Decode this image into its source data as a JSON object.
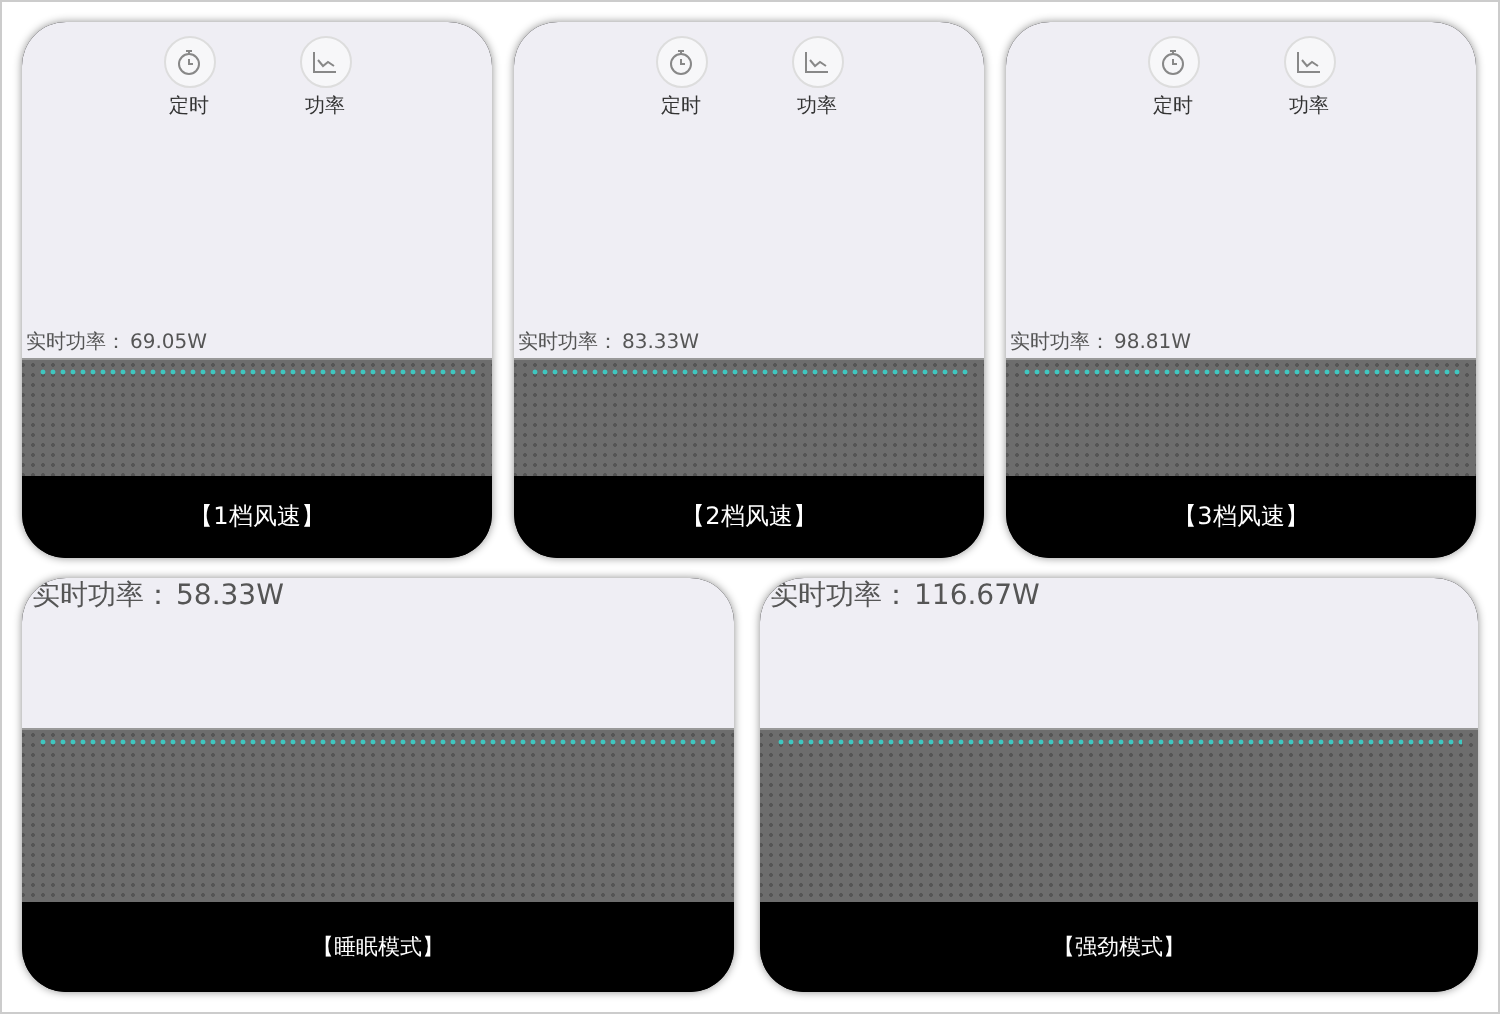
{
  "rows": [
    {
      "cards": [
        {
          "shortcuts": [
            {
              "kind": "timer",
              "label": "定时"
            },
            {
              "kind": "chart",
              "label": "功率"
            }
          ],
          "power_label": "实时功率：",
          "power_value": "69.05W",
          "mode": "【1档风速】"
        },
        {
          "shortcuts": [
            {
              "kind": "timer",
              "label": "定时"
            },
            {
              "kind": "chart",
              "label": "功率"
            }
          ],
          "power_label": "实时功率：",
          "power_value": "83.33W",
          "mode": "【2档风速】"
        },
        {
          "shortcuts": [
            {
              "kind": "timer",
              "label": "定时"
            },
            {
              "kind": "chart",
              "label": "功率"
            }
          ],
          "power_label": "实时功率：",
          "power_value": "98.81W",
          "mode": "【3档风速】"
        }
      ]
    },
    {
      "cards": [
        {
          "power_label": "实时功率：",
          "power_value": "58.33W",
          "mode": "【睡眠模式】"
        },
        {
          "power_label": "实时功率：",
          "power_value": "116.67W",
          "mode": "【强劲模式】"
        }
      ]
    }
  ]
}
